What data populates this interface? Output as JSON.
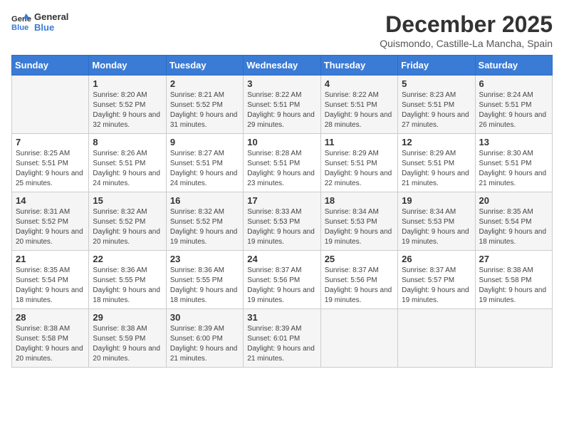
{
  "header": {
    "logo_line1": "General",
    "logo_line2": "Blue",
    "month_title": "December 2025",
    "subtitle": "Quismondo, Castille-La Mancha, Spain"
  },
  "days_of_week": [
    "Sunday",
    "Monday",
    "Tuesday",
    "Wednesday",
    "Thursday",
    "Friday",
    "Saturday"
  ],
  "weeks": [
    [
      {
        "day": "",
        "sunrise": "",
        "sunset": "",
        "daylight": ""
      },
      {
        "day": "1",
        "sunrise": "Sunrise: 8:20 AM",
        "sunset": "Sunset: 5:52 PM",
        "daylight": "Daylight: 9 hours and 32 minutes."
      },
      {
        "day": "2",
        "sunrise": "Sunrise: 8:21 AM",
        "sunset": "Sunset: 5:52 PM",
        "daylight": "Daylight: 9 hours and 31 minutes."
      },
      {
        "day": "3",
        "sunrise": "Sunrise: 8:22 AM",
        "sunset": "Sunset: 5:51 PM",
        "daylight": "Daylight: 9 hours and 29 minutes."
      },
      {
        "day": "4",
        "sunrise": "Sunrise: 8:22 AM",
        "sunset": "Sunset: 5:51 PM",
        "daylight": "Daylight: 9 hours and 28 minutes."
      },
      {
        "day": "5",
        "sunrise": "Sunrise: 8:23 AM",
        "sunset": "Sunset: 5:51 PM",
        "daylight": "Daylight: 9 hours and 27 minutes."
      },
      {
        "day": "6",
        "sunrise": "Sunrise: 8:24 AM",
        "sunset": "Sunset: 5:51 PM",
        "daylight": "Daylight: 9 hours and 26 minutes."
      }
    ],
    [
      {
        "day": "7",
        "sunrise": "Sunrise: 8:25 AM",
        "sunset": "Sunset: 5:51 PM",
        "daylight": "Daylight: 9 hours and 25 minutes."
      },
      {
        "day": "8",
        "sunrise": "Sunrise: 8:26 AM",
        "sunset": "Sunset: 5:51 PM",
        "daylight": "Daylight: 9 hours and 24 minutes."
      },
      {
        "day": "9",
        "sunrise": "Sunrise: 8:27 AM",
        "sunset": "Sunset: 5:51 PM",
        "daylight": "Daylight: 9 hours and 24 minutes."
      },
      {
        "day": "10",
        "sunrise": "Sunrise: 8:28 AM",
        "sunset": "Sunset: 5:51 PM",
        "daylight": "Daylight: 9 hours and 23 minutes."
      },
      {
        "day": "11",
        "sunrise": "Sunrise: 8:29 AM",
        "sunset": "Sunset: 5:51 PM",
        "daylight": "Daylight: 9 hours and 22 minutes."
      },
      {
        "day": "12",
        "sunrise": "Sunrise: 8:29 AM",
        "sunset": "Sunset: 5:51 PM",
        "daylight": "Daylight: 9 hours and 21 minutes."
      },
      {
        "day": "13",
        "sunrise": "Sunrise: 8:30 AM",
        "sunset": "Sunset: 5:51 PM",
        "daylight": "Daylight: 9 hours and 21 minutes."
      }
    ],
    [
      {
        "day": "14",
        "sunrise": "Sunrise: 8:31 AM",
        "sunset": "Sunset: 5:52 PM",
        "daylight": "Daylight: 9 hours and 20 minutes."
      },
      {
        "day": "15",
        "sunrise": "Sunrise: 8:32 AM",
        "sunset": "Sunset: 5:52 PM",
        "daylight": "Daylight: 9 hours and 20 minutes."
      },
      {
        "day": "16",
        "sunrise": "Sunrise: 8:32 AM",
        "sunset": "Sunset: 5:52 PM",
        "daylight": "Daylight: 9 hours and 19 minutes."
      },
      {
        "day": "17",
        "sunrise": "Sunrise: 8:33 AM",
        "sunset": "Sunset: 5:53 PM",
        "daylight": "Daylight: 9 hours and 19 minutes."
      },
      {
        "day": "18",
        "sunrise": "Sunrise: 8:34 AM",
        "sunset": "Sunset: 5:53 PM",
        "daylight": "Daylight: 9 hours and 19 minutes."
      },
      {
        "day": "19",
        "sunrise": "Sunrise: 8:34 AM",
        "sunset": "Sunset: 5:53 PM",
        "daylight": "Daylight: 9 hours and 19 minutes."
      },
      {
        "day": "20",
        "sunrise": "Sunrise: 8:35 AM",
        "sunset": "Sunset: 5:54 PM",
        "daylight": "Daylight: 9 hours and 18 minutes."
      }
    ],
    [
      {
        "day": "21",
        "sunrise": "Sunrise: 8:35 AM",
        "sunset": "Sunset: 5:54 PM",
        "daylight": "Daylight: 9 hours and 18 minutes."
      },
      {
        "day": "22",
        "sunrise": "Sunrise: 8:36 AM",
        "sunset": "Sunset: 5:55 PM",
        "daylight": "Daylight: 9 hours and 18 minutes."
      },
      {
        "day": "23",
        "sunrise": "Sunrise: 8:36 AM",
        "sunset": "Sunset: 5:55 PM",
        "daylight": "Daylight: 9 hours and 18 minutes."
      },
      {
        "day": "24",
        "sunrise": "Sunrise: 8:37 AM",
        "sunset": "Sunset: 5:56 PM",
        "daylight": "Daylight: 9 hours and 19 minutes."
      },
      {
        "day": "25",
        "sunrise": "Sunrise: 8:37 AM",
        "sunset": "Sunset: 5:56 PM",
        "daylight": "Daylight: 9 hours and 19 minutes."
      },
      {
        "day": "26",
        "sunrise": "Sunrise: 8:37 AM",
        "sunset": "Sunset: 5:57 PM",
        "daylight": "Daylight: 9 hours and 19 minutes."
      },
      {
        "day": "27",
        "sunrise": "Sunrise: 8:38 AM",
        "sunset": "Sunset: 5:58 PM",
        "daylight": "Daylight: 9 hours and 19 minutes."
      }
    ],
    [
      {
        "day": "28",
        "sunrise": "Sunrise: 8:38 AM",
        "sunset": "Sunset: 5:58 PM",
        "daylight": "Daylight: 9 hours and 20 minutes."
      },
      {
        "day": "29",
        "sunrise": "Sunrise: 8:38 AM",
        "sunset": "Sunset: 5:59 PM",
        "daylight": "Daylight: 9 hours and 20 minutes."
      },
      {
        "day": "30",
        "sunrise": "Sunrise: 8:39 AM",
        "sunset": "Sunset: 6:00 PM",
        "daylight": "Daylight: 9 hours and 21 minutes."
      },
      {
        "day": "31",
        "sunrise": "Sunrise: 8:39 AM",
        "sunset": "Sunset: 6:01 PM",
        "daylight": "Daylight: 9 hours and 21 minutes."
      },
      {
        "day": "",
        "sunrise": "",
        "sunset": "",
        "daylight": ""
      },
      {
        "day": "",
        "sunrise": "",
        "sunset": "",
        "daylight": ""
      },
      {
        "day": "",
        "sunrise": "",
        "sunset": "",
        "daylight": ""
      }
    ]
  ]
}
